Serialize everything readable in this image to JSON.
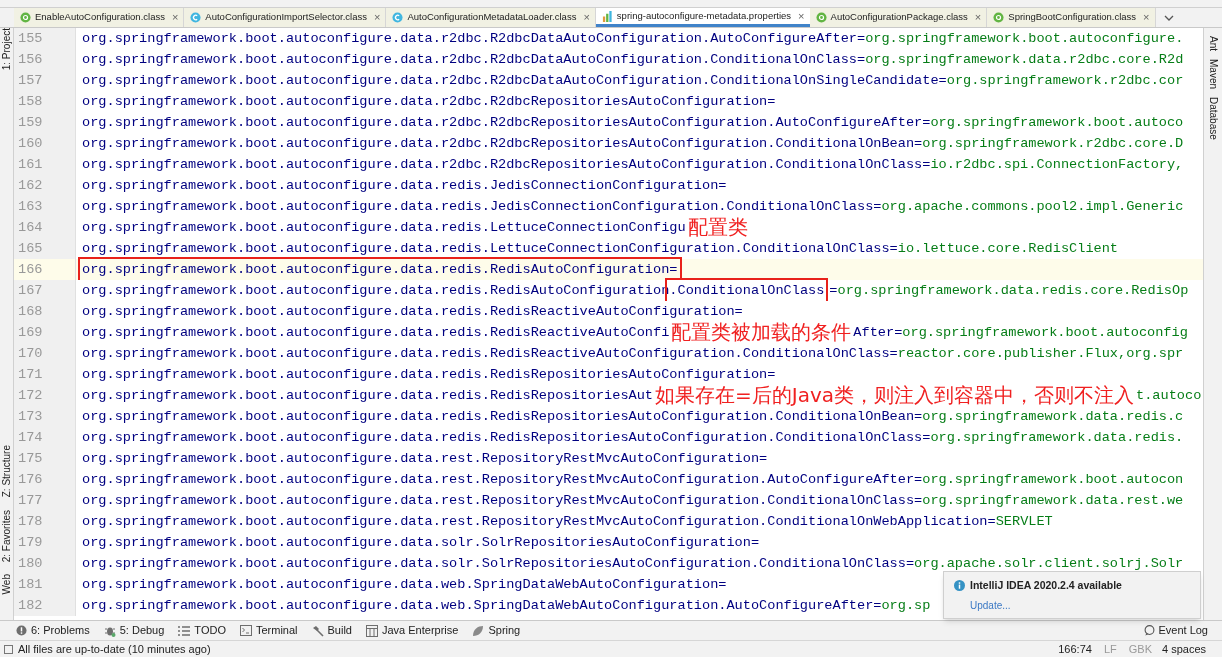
{
  "tabs": [
    {
      "label": "EnableAutoConfiguration.class",
      "kind": "annotation",
      "close": "×",
      "selected": false
    },
    {
      "label": "AutoConfigurationImportSelector.class",
      "kind": "class",
      "close": "×",
      "selected": false
    },
    {
      "label": "AutoConfigurationMetadataLoader.class",
      "kind": "class",
      "close": "×",
      "selected": false
    },
    {
      "label": "spring-autoconfigure-metadata.properties",
      "kind": "properties",
      "close": "×",
      "selected": true
    },
    {
      "label": "AutoConfigurationPackage.class",
      "kind": "annotation",
      "close": "×",
      "selected": false
    },
    {
      "label": "SpringBootConfiguration.class",
      "kind": "annotation",
      "close": "×",
      "selected": false
    }
  ],
  "left_tool_windows": [
    "1: Project",
    "Z: Structure",
    "2: Favorites",
    "Web"
  ],
  "right_tool_windows": [
    "Ant",
    "Maven",
    "Database"
  ],
  "lines": [
    {
      "number": "155",
      "current": false,
      "parts": [
        {
          "kind": "key",
          "text": "org.springframework.boot.autoconfigure.data.r2dbc.R2dbcDataAutoConfiguration.AutoConfigureAfter="
        },
        {
          "kind": "value",
          "text": "org.springframework.boot.autoconfigure."
        }
      ]
    },
    {
      "number": "156",
      "current": false,
      "parts": [
        {
          "kind": "key",
          "text": "org.springframework.boot.autoconfigure.data.r2dbc.R2dbcDataAutoConfiguration.ConditionalOnClass="
        },
        {
          "kind": "value",
          "text": "org.springframework.data.r2dbc.core.R2d"
        }
      ]
    },
    {
      "number": "157",
      "current": false,
      "parts": [
        {
          "kind": "key",
          "text": "org.springframework.boot.autoconfigure.data.r2dbc.R2dbcDataAutoConfiguration.ConditionalOnSingleCandidate="
        },
        {
          "kind": "value",
          "text": "org.springframework.r2dbc.cor"
        }
      ]
    },
    {
      "number": "158",
      "current": false,
      "parts": [
        {
          "kind": "key",
          "text": "org.springframework.boot.autoconfigure.data.r2dbc.R2dbcRepositoriesAutoConfiguration="
        }
      ]
    },
    {
      "number": "159",
      "current": false,
      "parts": [
        {
          "kind": "key",
          "text": "org.springframework.boot.autoconfigure.data.r2dbc.R2dbcRepositoriesAutoConfiguration.AutoConfigureAfter="
        },
        {
          "kind": "value",
          "text": "org.springframework.boot.autoco"
        }
      ]
    },
    {
      "number": "160",
      "current": false,
      "parts": [
        {
          "kind": "key",
          "text": "org.springframework.boot.autoconfigure.data.r2dbc.R2dbcRepositoriesAutoConfiguration.ConditionalOnBean="
        },
        {
          "kind": "value",
          "text": "org.springframework.r2dbc.core.D"
        }
      ]
    },
    {
      "number": "161",
      "current": false,
      "parts": [
        {
          "kind": "key",
          "text": "org.springframework.boot.autoconfigure.data.r2dbc.R2dbcRepositoriesAutoConfiguration.ConditionalOnClass="
        },
        {
          "kind": "value",
          "text": "io.r2dbc.spi.ConnectionFactory,"
        }
      ]
    },
    {
      "number": "162",
      "current": false,
      "parts": [
        {
          "kind": "key",
          "text": "org.springframework.boot.autoconfigure.data.redis.JedisConnectionConfiguration="
        }
      ]
    },
    {
      "number": "163",
      "current": false,
      "parts": [
        {
          "kind": "key",
          "text": "org.springframework.boot.autoconfigure.data.redis.JedisConnectionConfiguration.ConditionalOnClass="
        },
        {
          "kind": "value",
          "text": "org.apache.commons.pool2.impl.Generic"
        }
      ]
    },
    {
      "number": "164",
      "current": false,
      "parts": [
        {
          "kind": "key",
          "text": "org.springframework.boot.autoconfigure.data.redis.LettuceConnectionConfigu"
        },
        {
          "kind": "note",
          "text": "配置类"
        }
      ]
    },
    {
      "number": "165",
      "current": false,
      "parts": [
        {
          "kind": "key",
          "text": "org.springframework.boot.autoconfigure.data.redis.LettuceConnectionConfiguration.ConditionalOnClass="
        },
        {
          "kind": "value",
          "text": "io.lettuce.core.RedisClient"
        }
      ]
    },
    {
      "number": "166",
      "current": true,
      "parts": [
        {
          "kind": "boxed-key",
          "text": "org.springframework.boot.autoconfigure.data.redis.RedisAutoConfiguration="
        }
      ]
    },
    {
      "number": "167",
      "current": false,
      "parts": [
        {
          "kind": "key",
          "text": "org.springframework.boot.autoconfigure.data.redis.RedisAutoConfiguration"
        },
        {
          "kind": "boxed-key",
          "text": ".ConditionalOnClass"
        },
        {
          "kind": "key",
          "text": "="
        },
        {
          "kind": "value",
          "text": "org.springframework.data.redis.core.RedisOp"
        }
      ]
    },
    {
      "number": "168",
      "current": false,
      "parts": [
        {
          "kind": "key",
          "text": "org.springframework.boot.autoconfigure.data.redis.RedisReactiveAutoConfiguration="
        }
      ]
    },
    {
      "number": "169",
      "current": false,
      "parts": [
        {
          "kind": "key",
          "text": "org.springframework.boot.autoconfigure.data.redis.RedisReactiveAutoConfi"
        },
        {
          "kind": "note",
          "text": "配置类被加载的条件"
        },
        {
          "kind": "key",
          "text": "After="
        },
        {
          "kind": "value",
          "text": "org.springframework.boot.autoconfig"
        }
      ]
    },
    {
      "number": "170",
      "current": false,
      "parts": [
        {
          "kind": "key",
          "text": "org.springframework.boot.autoconfigure.data.redis.RedisReactiveAutoConfiguration.ConditionalOnClass="
        },
        {
          "kind": "value",
          "text": "reactor.core.publisher.Flux,org.spr"
        }
      ]
    },
    {
      "number": "171",
      "current": false,
      "parts": [
        {
          "kind": "key",
          "text": "org.springframework.boot.autoconfigure.data.redis.RedisRepositoriesAutoConfiguration="
        }
      ]
    },
    {
      "number": "172",
      "current": false,
      "parts": [
        {
          "kind": "key",
          "text": "org.springframework.boot.autoconfigure.data.redis.RedisRepositoriesAut"
        },
        {
          "kind": "note",
          "text": "如果存在=后的Java类，则注入到容器中，否则不注入"
        },
        {
          "kind": "value",
          "text": "t.autoco"
        }
      ]
    },
    {
      "number": "173",
      "current": false,
      "parts": [
        {
          "kind": "key",
          "text": "org.springframework.boot.autoconfigure.data.redis.RedisRepositoriesAutoConfiguration.ConditionalOnBean="
        },
        {
          "kind": "value",
          "text": "org.springframework.data.redis.c"
        }
      ]
    },
    {
      "number": "174",
      "current": false,
      "parts": [
        {
          "kind": "key",
          "text": "org.springframework.boot.autoconfigure.data.redis.RedisRepositoriesAutoConfiguration.ConditionalOnClass="
        },
        {
          "kind": "value",
          "text": "org.springframework.data.redis."
        }
      ]
    },
    {
      "number": "175",
      "current": false,
      "parts": [
        {
          "kind": "key",
          "text": "org.springframework.boot.autoconfigure.data.rest.RepositoryRestMvcAutoConfiguration="
        }
      ]
    },
    {
      "number": "176",
      "current": false,
      "parts": [
        {
          "kind": "key",
          "text": "org.springframework.boot.autoconfigure.data.rest.RepositoryRestMvcAutoConfiguration.AutoConfigureAfter="
        },
        {
          "kind": "value",
          "text": "org.springframework.boot.autocon"
        }
      ]
    },
    {
      "number": "177",
      "current": false,
      "parts": [
        {
          "kind": "key",
          "text": "org.springframework.boot.autoconfigure.data.rest.RepositoryRestMvcAutoConfiguration.ConditionalOnClass="
        },
        {
          "kind": "value",
          "text": "org.springframework.data.rest.we"
        }
      ]
    },
    {
      "number": "178",
      "current": false,
      "parts": [
        {
          "kind": "key",
          "text": "org.springframework.boot.autoconfigure.data.rest.RepositoryRestMvcAutoConfiguration.ConditionalOnWebApplication="
        },
        {
          "kind": "value",
          "text": "SERVLET"
        }
      ]
    },
    {
      "number": "179",
      "current": false,
      "parts": [
        {
          "kind": "key",
          "text": "org.springframework.boot.autoconfigure.data.solr.SolrRepositoriesAutoConfiguration="
        }
      ]
    },
    {
      "number": "180",
      "current": false,
      "parts": [
        {
          "kind": "key",
          "text": "org.springframework.boot.autoconfigure.data.solr.SolrRepositoriesAutoConfiguration.ConditionalOnClass="
        },
        {
          "kind": "value",
          "text": "org.apache.solr.client.solrj.Solr"
        }
      ]
    },
    {
      "number": "181",
      "current": false,
      "parts": [
        {
          "kind": "key",
          "text": "org.springframework.boot.autoconfigure.data.web.SpringDataWebAutoConfiguration="
        }
      ]
    },
    {
      "number": "182",
      "current": false,
      "parts": [
        {
          "kind": "key",
          "text": "org.springframework.boot.autoconfigure.data.web.SpringDataWebAutoConfiguration.AutoConfigureAfter="
        },
        {
          "kind": "value",
          "text": "org.sp"
        }
      ]
    }
  ],
  "notification": {
    "title": "IntelliJ IDEA 2020.2.4 available",
    "link": "Update..."
  },
  "tool_buttons": [
    {
      "label": "6: Problems",
      "kind": "problems"
    },
    {
      "label": "5: Debug",
      "kind": "debug"
    },
    {
      "label": "TODO",
      "kind": "todo"
    },
    {
      "label": "Terminal",
      "kind": "terminal"
    },
    {
      "label": "Build",
      "kind": "build"
    },
    {
      "label": "Java Enterprise",
      "kind": "enterprise"
    },
    {
      "label": "Spring",
      "kind": "spring"
    }
  ],
  "event_log": "Event Log",
  "status_bar": {
    "message": "All files are up-to-date (10 minutes ago)",
    "position": "166:74",
    "line_separator": "LF",
    "encoding": "GBK",
    "indent": "4 spaces"
  }
}
